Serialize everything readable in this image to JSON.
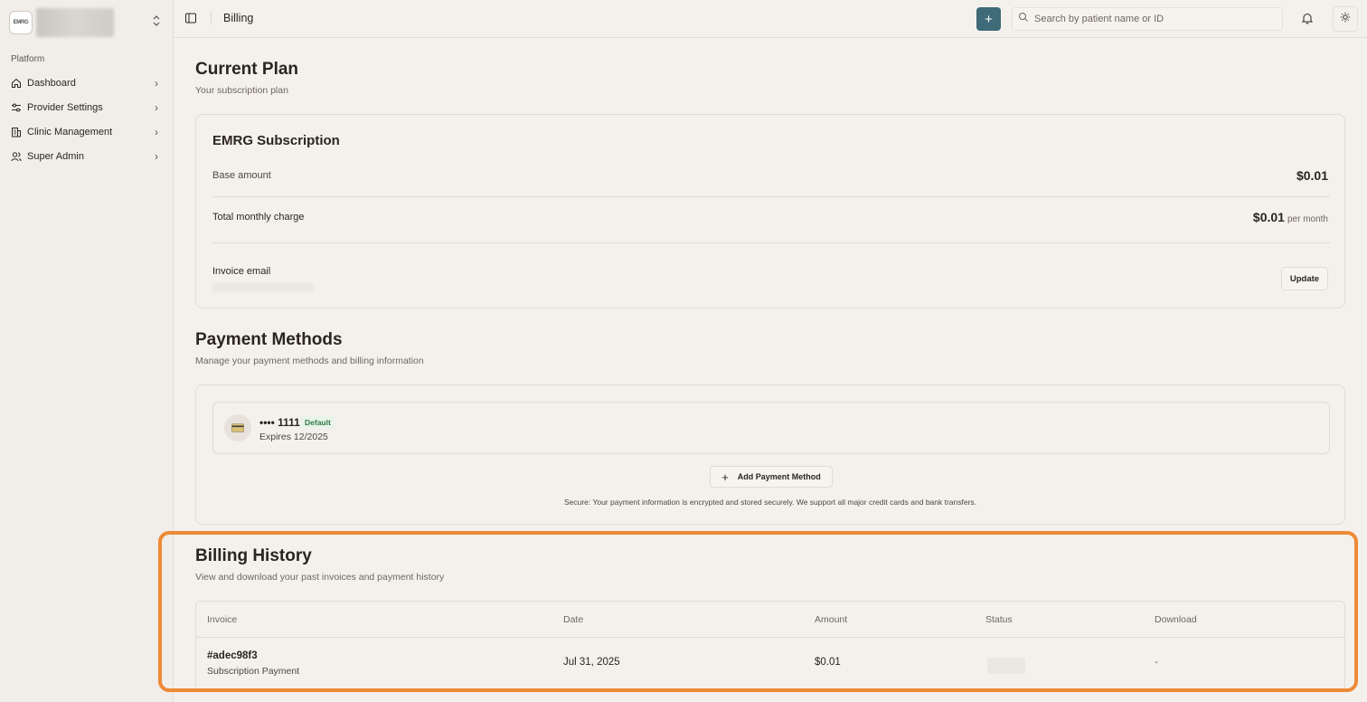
{
  "sidebar": {
    "org_logo_text": "EMRG",
    "section_label": "Platform",
    "items": [
      {
        "label": "Dashboard",
        "icon": "home-icon"
      },
      {
        "label": "Provider Settings",
        "icon": "sliders-icon"
      },
      {
        "label": "Clinic Management",
        "icon": "building-icon"
      },
      {
        "label": "Super Admin",
        "icon": "users-icon"
      }
    ]
  },
  "topbar": {
    "title": "Billing",
    "search_placeholder": "Search by patient name or ID",
    "accent_color": "#3f6a78"
  },
  "current_plan": {
    "heading": "Current Plan",
    "subheading": "Your subscription plan",
    "plan_name": "EMRG Subscription",
    "base_label": "Base amount",
    "base_value": "$0.01",
    "total_label": "Total monthly charge",
    "total_value": "$0.01",
    "total_suffix": "per month",
    "invoice_email_label": "Invoice email",
    "update_label": "Update"
  },
  "payment_methods": {
    "heading": "Payment Methods",
    "subheading": "Manage your payment methods and billing information",
    "card_number": "•••• 1111",
    "default_badge": "Default",
    "expires": "Expires 12/2025",
    "add_label": "Add Payment Method",
    "secure_note": "Secure: Your payment information is encrypted and stored securely. We support all major credit cards and bank transfers."
  },
  "billing_history": {
    "heading": "Billing History",
    "subheading": "View and download your past invoices and payment history",
    "highlight_color": "#ed8a36",
    "columns": [
      "Invoice",
      "Date",
      "Amount",
      "Status",
      "Download"
    ],
    "rows": [
      {
        "invoice": "#adec98f3",
        "description": "Subscription Payment",
        "date": "Jul 31, 2025",
        "amount": "$0.01",
        "status": "",
        "download": "-"
      }
    ]
  }
}
